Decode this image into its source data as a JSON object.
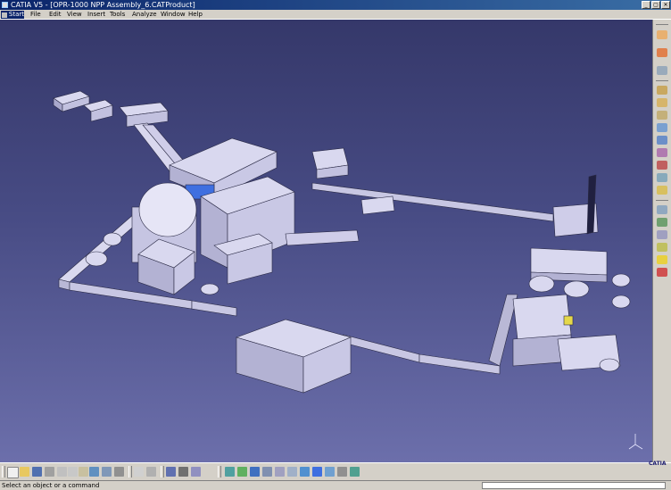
{
  "window": {
    "title": "CATIA V5 - [OPR-1000 NPP Assembly_6.CATProduct]",
    "buttons": [
      "_",
      "▢",
      "✕"
    ]
  },
  "menubar": {
    "start_label": "Start",
    "items": [
      "File",
      "Edit",
      "View",
      "Insert",
      "Tools",
      "Analyze",
      "Window",
      "Help"
    ]
  },
  "viewport": {
    "model_name": "OPR-1000 NPP Assembly_6",
    "axis_label": "z"
  },
  "logo_text": "CATIA",
  "status_bar": {
    "message": "Select an object or a command",
    "command_value": ""
  },
  "right_toolbar": {
    "icons": [
      "select-icon",
      "sketch-icon",
      "part-icon",
      "product-icon",
      "assembly-icon",
      "component-icon",
      "existing-component-icon",
      "replace-icon",
      "reorder-icon",
      "manipulate-icon",
      "snap-icon",
      "fix-icon",
      "constraint-icon",
      "update-icon",
      "bill-of-material-icon",
      "publish-icon",
      "light-icon",
      "explode-icon"
    ]
  },
  "bottom_toolbar": {
    "icons": [
      "new-icon",
      "open-icon",
      "save-icon",
      "print-icon",
      "cut-icon",
      "copy-icon",
      "paste-icon",
      "undo-icon",
      "redo-icon",
      "whats-this-icon",
      "formula-icon",
      "knowledge-icon",
      "catalog-icon",
      "fly-icon",
      "fit-all-icon",
      "pan-icon",
      "rotate-icon",
      "zoom-in-icon",
      "zoom-out-icon",
      "normal-view-icon",
      "views-icon",
      "render-style-icon",
      "hide-show-icon",
      "swap-visible-icon",
      "measure-icon"
    ]
  },
  "colors": {
    "title_active": "#0a246a",
    "viewport_top": "#35386a",
    "viewport_bottom": "#6c6fab",
    "model_fill": "#d9d8ef",
    "model_edge": "#2a2a45",
    "accent_blue": "#3f6fe0"
  }
}
